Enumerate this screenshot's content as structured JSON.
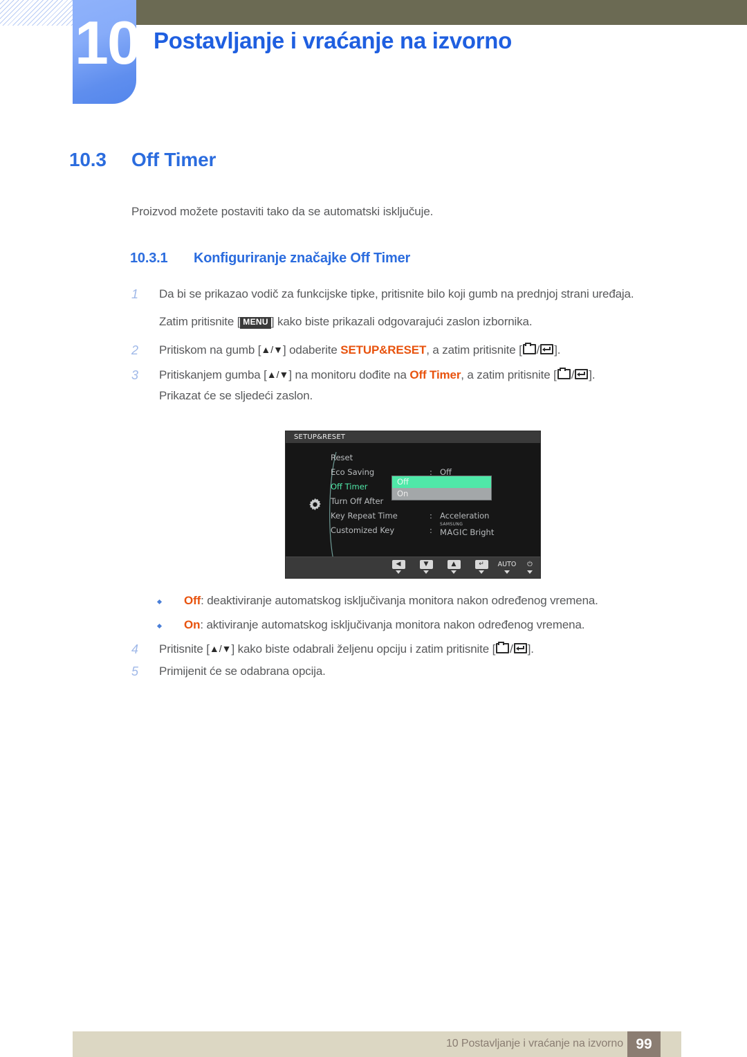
{
  "header": {
    "chapter_number": "10",
    "chapter_title": "Postavljanje i vraćanje na izvorno"
  },
  "section": {
    "number": "10.3",
    "title": "Off Timer",
    "intro": "Proizvod možete postaviti tako da se automatski isključuje.",
    "sub_number": "10.3.1",
    "sub_title": "Konfiguriranje značajke Off Timer"
  },
  "steps": {
    "s1_num": "1",
    "s1_text": "Da bi se prikazao vodič za funkcijske tipke, pritisnite bilo koji gumb na prednjoj strani uređaja.",
    "s1_sub_a": "Zatim pritisnite [",
    "s1_key": "MENU",
    "s1_sub_b": "] kako biste prikazali odgovarajući zaslon izbornika.",
    "s2_num": "2",
    "s2_a": "Pritiskom na gumb [",
    "s2_arrows": "▲/▼",
    "s2_b": "] odaberite ",
    "s2_hl": "SETUP&RESET",
    "s2_c": ", a zatim pritisnite [",
    "s2_d": "].",
    "s3_num": "3",
    "s3_a": "Pritiskanjem gumba [",
    "s3_arrows": "▲/▼",
    "s3_b": "] na monitoru dođite na ",
    "s3_hl": "Off Timer",
    "s3_c": ", a zatim pritisnite [",
    "s3_d": "].",
    "s3_sub": "Prikazat će se sljedeći zaslon.",
    "s4_num": "4",
    "s4_a": "Pritisnite [",
    "s4_arrows": "▲/▼",
    "s4_b": "] kako biste odabrali željenu opciju i zatim pritisnite [",
    "s4_c": "].",
    "s5_num": "5",
    "s5_text": "Primijenit će se odabrana opcija."
  },
  "bullets": [
    {
      "label": "Off",
      "text": ": deaktiviranje automatskog isključivanja monitora nakon određenog vremena."
    },
    {
      "label": "On",
      "text": ": aktiviranje automatskog isključivanja monitora nakon određenog vremena."
    }
  ],
  "osd": {
    "title": "SETUP&RESET",
    "rows": [
      {
        "label": "Reset",
        "colon": "",
        "value": ""
      },
      {
        "label": "Eco Saving",
        "colon": ":",
        "value": "Off"
      },
      {
        "label": "Off Timer",
        "colon": ":",
        "value": ""
      },
      {
        "label": "Turn Off After",
        "colon": "",
        "value": ""
      },
      {
        "label": "Key Repeat Time",
        "colon": ":",
        "value": "Acceleration"
      },
      {
        "label": "Customized Key",
        "colon": ":",
        "value": ""
      }
    ],
    "dropdown": {
      "selected": "Off",
      "other": "On"
    },
    "magic": {
      "samsung": "SAMSUNG",
      "magic": "MAGIC",
      "bright": "Bright"
    },
    "buttons": [
      {
        "name": "left",
        "glyph": "◀",
        "type": "glyph"
      },
      {
        "name": "down",
        "glyph": "▼",
        "type": "glyph"
      },
      {
        "name": "up",
        "glyph": "▲",
        "type": "glyph"
      },
      {
        "name": "enter",
        "glyph": "↵",
        "type": "glyph"
      },
      {
        "name": "auto",
        "glyph": "AUTO",
        "type": "text"
      },
      {
        "name": "power",
        "glyph": "⏻",
        "type": "text"
      }
    ]
  },
  "footer": {
    "text": "10 Postavljanje i vraćanje na izvorno",
    "page": "99"
  },
  "colors": {
    "heading_blue": "#2b6cde",
    "highlight_orange": "#e8530e",
    "osd_green": "#4fe8a8",
    "topbar_olive": "#6b6a53",
    "footer_beige": "#dcd7c3",
    "page_box_brown": "#8b7d72"
  }
}
